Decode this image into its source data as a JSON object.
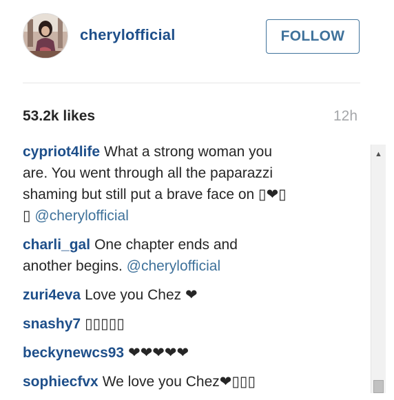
{
  "post": {
    "username": "cherylofficial",
    "follow_label": "FOLLOW",
    "likes": "53.2k likes",
    "time": "12h"
  },
  "comments": [
    {
      "user": "cypriot4life",
      "text_lines": [
        "What a strong woman you",
        "are. You went through all the paparazzi",
        "shaming but still put a brave face on ▯❤▯",
        "▯"
      ],
      "mention": "@cherylofficial"
    },
    {
      "user": "charli_gal",
      "text_lines": [
        "One chapter ends and",
        "another begins."
      ],
      "mention": "@cherylofficial"
    },
    {
      "user": "zuri4eva",
      "text": "Love you Chez ❤"
    },
    {
      "user": "snashy7",
      "text": "▯▯▯▯▯"
    },
    {
      "user": "beckynewcs93",
      "text": "❤❤❤❤❤"
    },
    {
      "user": "sophiecfvx",
      "text": "We love you Chez❤▯▯▯"
    }
  ],
  "scrollbar": {
    "up_arrow": "▲",
    "thumb_position": 0.95
  },
  "colors": {
    "username": "#1e4f8a",
    "mention": "#3f729b",
    "follow_border": "#3f729b",
    "time": "#a5a7aa"
  }
}
